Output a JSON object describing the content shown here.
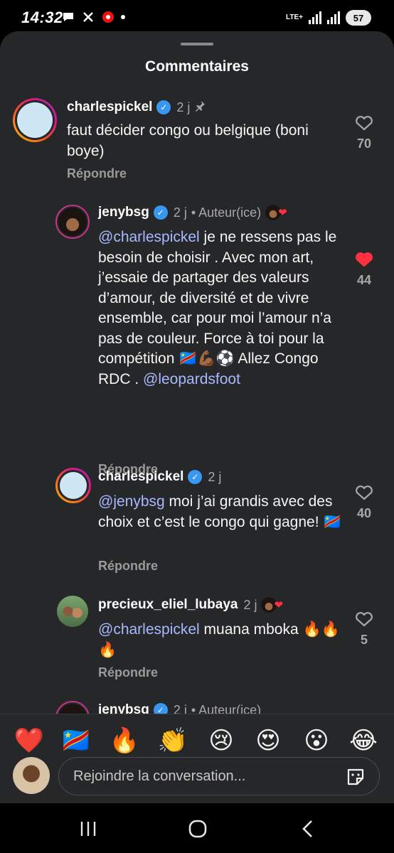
{
  "status_bar": {
    "time": "14:32",
    "network": "LTE+",
    "battery": "57"
  },
  "sheet": {
    "title": "Commentaires"
  },
  "comments": [
    {
      "username": "charlespickel",
      "time": "2 j",
      "text": "faut décider congo ou belgique (boni boye)",
      "reply_label": "Répondre",
      "likes": "70"
    },
    {
      "username": "jenybsg",
      "time": "2 j",
      "author_label": "• Auteur(ice)",
      "mention": "@charlespickel",
      "text": " je ne ressens pas le besoin de choisir . Avec mon art, j’essaie de partager des valeurs d’amour, de diversité et de vivre ensemble, car pour moi l’amour n’a pas de couleur. Force à toi pour la compétition 🇨🇩💪🏾⚽️ Allez Congo RDC . ",
      "mention2": "@leopardsfoot",
      "reply_label": "Répondre",
      "likes": "44"
    },
    {
      "username": "charlespickel",
      "time": "2 j",
      "mention": "@jenybsg",
      "text": " moi j’ai grandis avec des choix et c’est le congo qui gagne! 🇨🇩",
      "reply_label": "Répondre",
      "likes": "40"
    },
    {
      "username": "precieux_eliel_lubaya",
      "time": "2 j",
      "mention": "@charlespickel",
      "text": " muana mboka 🔥🔥🔥",
      "reply_label": "Répondre",
      "likes": "5"
    },
    {
      "username": "jenybsg",
      "time": "2 j",
      "author_label": "• Auteur(ice)"
    }
  ],
  "emoji_bar": [
    "❤️",
    "🇨🇩",
    "🔥",
    "👏",
    "😢",
    "😍",
    "😮",
    "😂"
  ],
  "input": {
    "placeholder": "Rejoindre la conversation..."
  },
  "icons": {
    "pin": "pin-icon",
    "verified": "verified-badge-icon",
    "heart": "heart-icon",
    "gif": "gif-sticker-icon"
  },
  "colors": {
    "mention": "#a9b9ff",
    "liked_heart": "#ff3040",
    "verified": "#3897f0"
  }
}
